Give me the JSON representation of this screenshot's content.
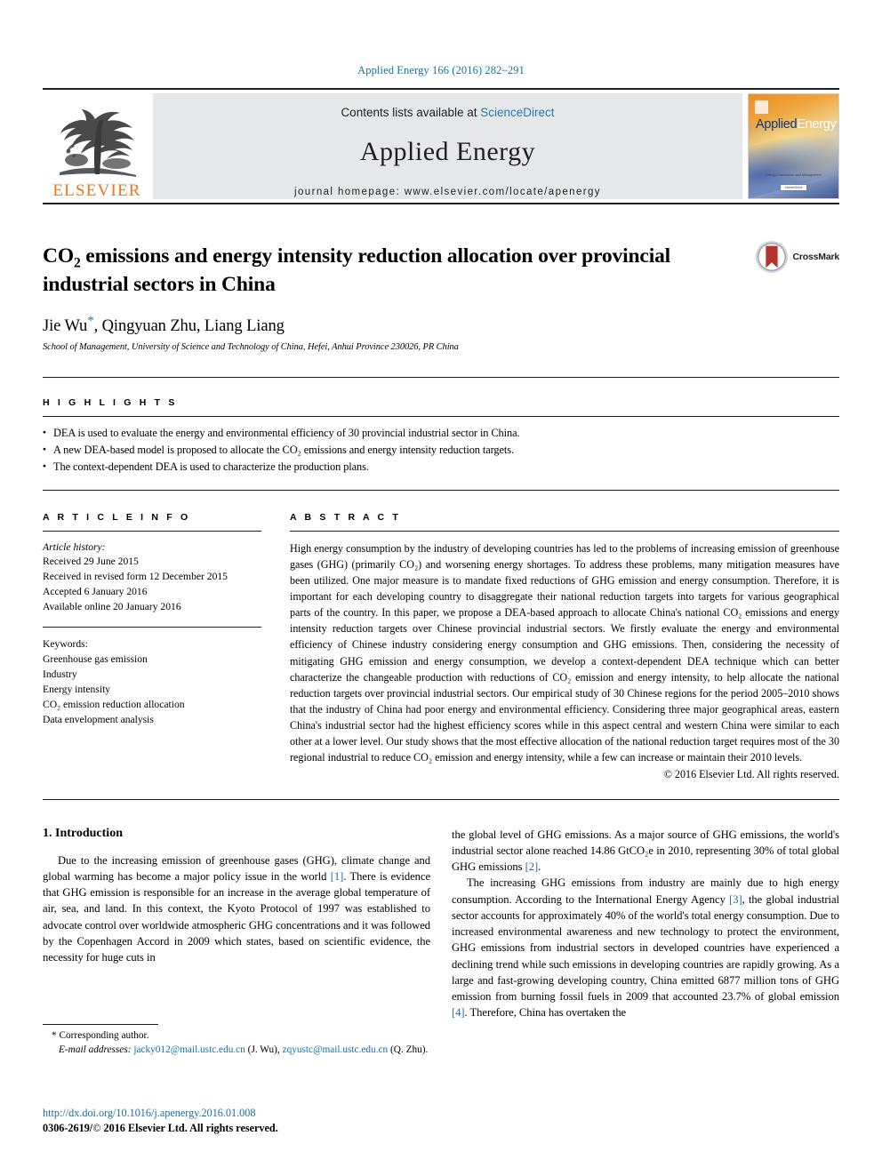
{
  "running_head": "Applied Energy 166 (2016) 282–291",
  "masthead": {
    "publisher_name": "ELSEVIER",
    "contents_prefix": "Contents lists available at ",
    "contents_link": "ScienceDirect",
    "journal_title": "Applied Energy",
    "homepage": "journal homepage: www.elsevier.com/locate/apenergy",
    "cover": {
      "title_part1": "Applied",
      "title_part2": "Energy",
      "footer_line": "Energy Conversion and Management",
      "footer_badge": "ScienceDirect"
    }
  },
  "article": {
    "title_line1_pre": "CO",
    "title_sub": "2",
    "title_line1_post": " emissions and energy intensity reduction allocation over provincial",
    "title_line2": "industrial sectors in China",
    "authors": "Jie Wu",
    "author_marker": "*",
    "authors_rest": ", Qingyuan Zhu, Liang Liang",
    "affiliation": "School of Management, University of Science and Technology of China, Hefei, Anhui Province 230026, PR China",
    "crossmark_label": "CrossMark"
  },
  "highlights": {
    "label": "H I G H L I G H T S",
    "items": [
      "DEA is used to evaluate the energy and environmental efficiency of 30 provincial industrial sector in China.",
      "A new DEA-based model is proposed to allocate the CO₂ emissions and energy intensity reduction targets.",
      "The context-dependent DEA is used to characterize the production plans."
    ]
  },
  "article_info": {
    "label": "A R T I C L E  I N F O",
    "history_label": "Article history:",
    "history": [
      "Received 29 June 2015",
      "Received in revised form 12 December 2015",
      "Accepted 6 January 2016",
      "Available online 20 January 2016"
    ],
    "keywords_label": "Keywords:",
    "keywords": [
      "Greenhouse gas emission",
      "Industry",
      "Energy intensity",
      "CO₂ emission reduction allocation",
      "Data envelopment analysis"
    ]
  },
  "abstract": {
    "label": "A B S T R A C T",
    "text": "High energy consumption by the industry of developing countries has led to the problems of increasing emission of greenhouse gases (GHG) (primarily CO₂) and worsening energy shortages. To address these problems, many mitigation measures have been utilized. One major measure is to mandate fixed reductions of GHG emission and energy consumption. Therefore, it is important for each developing country to disaggregate their national reduction targets into targets for various geographical parts of the country. In this paper, we propose a DEA-based approach to allocate China's national CO₂ emissions and energy intensity reduction targets over Chinese provincial industrial sectors. We firstly evaluate the energy and environmental efficiency of Chinese industry considering energy consumption and GHG emissions. Then, considering the necessity of mitigating GHG emission and energy consumption, we develop a context-dependent DEA technique which can better characterize the changeable production with reductions of CO₂ emission and energy intensity, to help allocate the national reduction targets over provincial industrial sectors. Our empirical study of 30 Chinese regions for the period 2005–2010 shows that the industry of China had poor energy and environmental efficiency. Considering three major geographical areas, eastern China's industrial sector had the highest efficiency scores while in this aspect central and western China were similar to each other at a lower level. Our study shows that the most effective allocation of the national reduction target requires most of the 30 regional industrial to reduce CO₂ emission and energy intensity, while a few can increase or maintain their 2010 levels.",
    "copyright": "© 2016 Elsevier Ltd. All rights reserved."
  },
  "introduction": {
    "heading": "1. Introduction",
    "left_p1_a": "Due to the increasing emission of greenhouse gases (GHG), climate change and global warming has become a major policy issue in the world ",
    "left_p1_ref1": "[1]",
    "left_p1_b": ". There is evidence that GHG emission is responsible for an increase in the average global temperature of air, sea, and land. In this context, the Kyoto Protocol of 1997 was established to advocate control over worldwide atmospheric GHG concentrations and it was followed by the Copenhagen Accord in 2009 which states, based on scientific evidence, the necessity for huge cuts in",
    "right_p1_a": "the global level of GHG emissions. As a major source of GHG emissions, the world's industrial sector alone reached 14.86 GtCO₂e in 2010, representing 30% of total global GHG emissions ",
    "right_p1_ref": "[2]",
    "right_p1_b": ".",
    "right_p2_a": "The increasing GHG emissions from industry are mainly due to high energy consumption. According to the International Energy Agency ",
    "right_p2_ref3": "[3]",
    "right_p2_b": ", the global industrial sector accounts for approximately 40% of the world's total energy consumption. Due to increased environmental awareness and new technology to protect the environment, GHG emissions from industrial sectors in developed countries have experienced a declining trend while such emissions in developing countries are rapidly growing. As a large and fast-growing developing country, China emitted 6877 million tons of GHG emission from burning fossil fuels in 2009 that accounted 23.7% of global emission ",
    "right_p2_ref4": "[4]",
    "right_p2_c": ". Therefore, China has overtaken the"
  },
  "footnote": {
    "corresponding_marker": "*",
    "corresponding_text": " Corresponding author.",
    "email_label": "E-mail addresses:",
    "email1": "jacky012@mail.ustc.edu.cn",
    "email1_owner": " (J. Wu), ",
    "email2": "zqyustc@mail.ustc.edu.cn",
    "email2_owner": "(Q. Zhu)."
  },
  "footer": {
    "doi": "http://dx.doi.org/10.1016/j.apenergy.2016.01.008",
    "issn_pre": "0306-2619/",
    "issn_copy": "©",
    "issn_post": " 2016 Elsevier Ltd. All rights reserved."
  },
  "colors": {
    "link_blue": "#1a6ea8",
    "sciencedirect_blue": "#2a7ab0",
    "elsevier_orange": "#e87722",
    "crossmark_red": "#b5322e"
  }
}
